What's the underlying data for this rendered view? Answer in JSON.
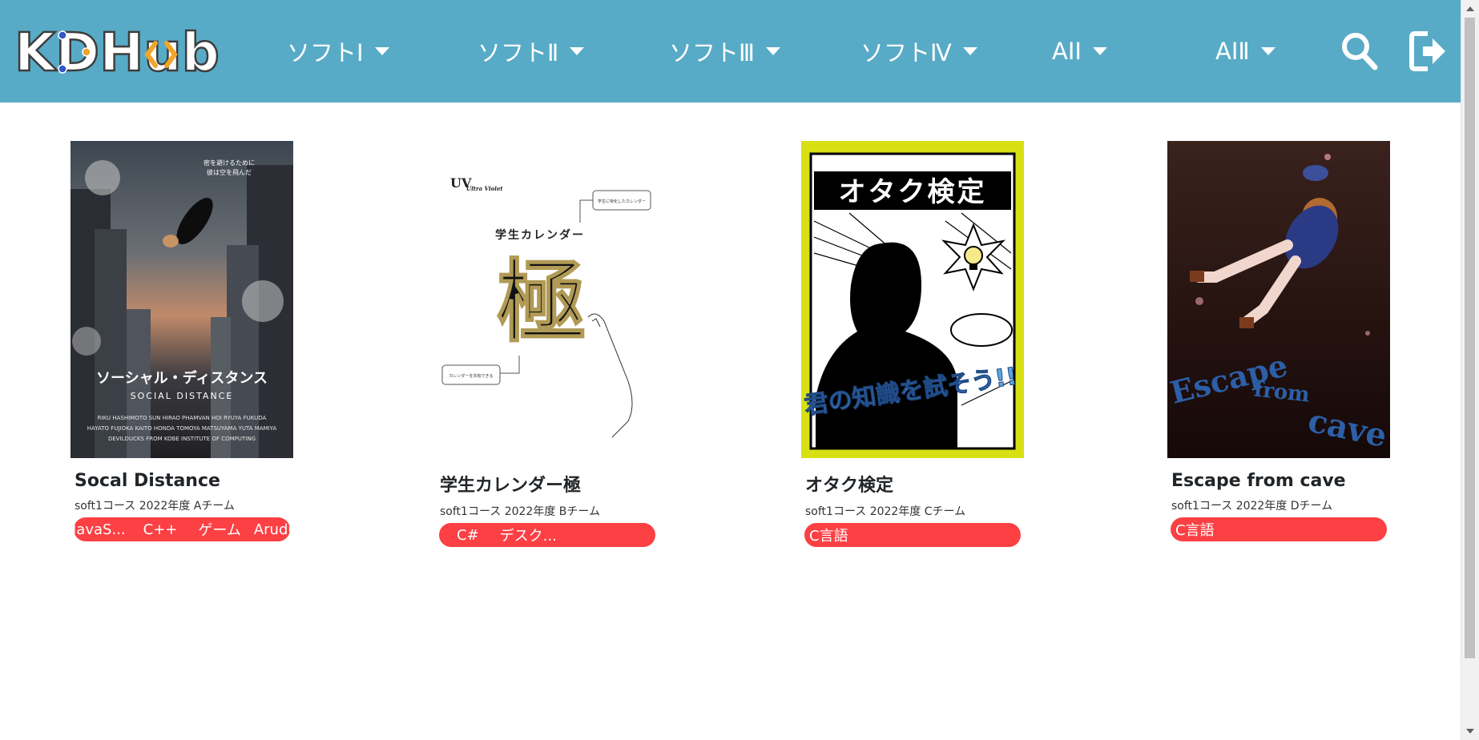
{
  "header": {
    "logo_text": "KDHub",
    "nav": [
      {
        "label": "ソフトⅠ"
      },
      {
        "label": "ソフトⅡ"
      },
      {
        "label": "ソフトⅢ"
      },
      {
        "label": "ソフトⅣ"
      },
      {
        "label": "AIⅠ"
      },
      {
        "label": "AIⅡ"
      }
    ],
    "icons": [
      "search-icon",
      "logout-icon"
    ]
  },
  "colors": {
    "header_bg": "#58abc6",
    "tag_bg": "#fc4044",
    "poster4_bg": "#2a1512",
    "poster3_bg": "#d8e014"
  },
  "cards": [
    {
      "title": "Socal Distance",
      "meta": "soft1コース 2022年度 Aチーム",
      "tags": [
        "JavaS...",
        "C++",
        "ゲーム",
        "Arudu..."
      ],
      "poster": {
        "title_jp": "ソーシャル・ディスタンス",
        "title_en": "SOCIAL DISTANCE",
        "tagline_1": "密を避けるために",
        "tagline_2": "彼は空を飛んだ",
        "credits_1": "RIKU HASHIMOTO  SUN HIRAO  PHAMVAN HOI  RYUYA FUKUDA",
        "credits_2": "HAYATO FUJIOKA  KAITO HONDA  TOMOYA MATSUYAMA  YUTA MAMIYA",
        "credits_3": "DEVILDUCKS FROM KOBE INSTITUTE OF COMPUTING"
      }
    },
    {
      "title": "学生カレンダー極",
      "meta": "soft1コース 2022年度 Bチーム",
      "tags": [
        "C#",
        "デスク..."
      ],
      "poster": {
        "brand": "Ultra Violet",
        "brand_mark": "UV",
        "heading": "学生カレンダー",
        "kanji": "極",
        "callout_1": "学生に特化したカレンダー",
        "callout_2": "カレンダーを共有できる"
      }
    },
    {
      "title": "オタク検定",
      "meta": "soft1コース 2022年度 Cチーム",
      "tags": [
        "C言語"
      ],
      "poster": {
        "heading": "オタク検定",
        "slogan": "君の知識を試そう!!"
      }
    },
    {
      "title": "Escape from cave",
      "meta": "soft1コース 2022年度 Dチーム",
      "tags": [
        "C言語"
      ],
      "poster": {
        "word_1": "Escape",
        "word_2": "from",
        "word_3": "cave"
      }
    }
  ]
}
